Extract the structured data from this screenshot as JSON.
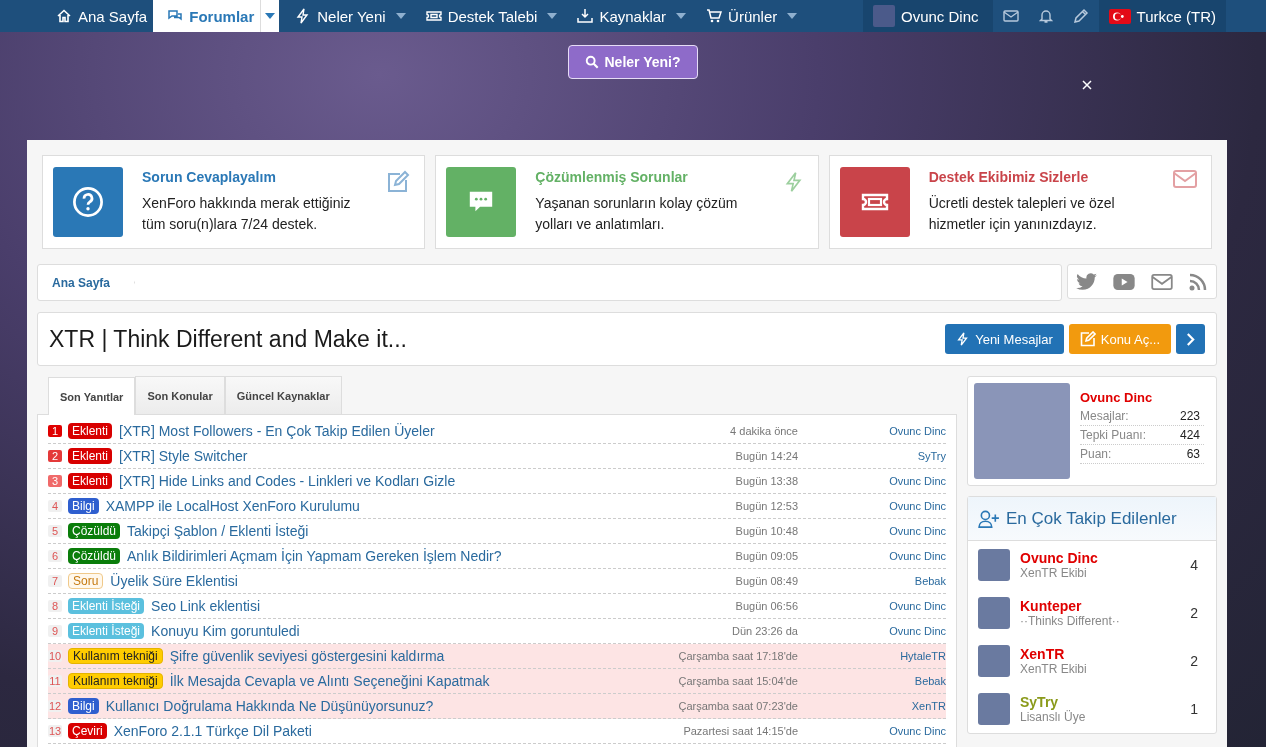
{
  "nav": {
    "items": [
      {
        "label": "Ana Sayfa",
        "kind": "home",
        "dropdown": false,
        "selected": false
      },
      {
        "label": "Forumlar",
        "kind": "chat",
        "dropdown": true,
        "selected": true
      },
      {
        "label": "Neler Yeni",
        "kind": "bolt",
        "dropdown": true,
        "selected": false
      },
      {
        "label": "Destek Talebi",
        "kind": "ticket",
        "dropdown": true,
        "selected": false
      },
      {
        "label": "Kaynaklar",
        "kind": "download",
        "dropdown": true,
        "selected": false
      },
      {
        "label": "Ürünler",
        "kind": "cart",
        "dropdown": true,
        "selected": false
      }
    ],
    "user": "Ovunc Dinc",
    "language": "Turkce (TR)"
  },
  "hero": {
    "button": "Neler Yeni?"
  },
  "features": [
    {
      "kind": "question",
      "title": "Sorun Cevaplayalım",
      "text": "XenForo hakkında merak ettiğiniz tüm soru(n)lara 7/24 destek.",
      "color": "#2a78b6"
    },
    {
      "kind": "solved",
      "title": "Çözümlenmiş Sorunlar",
      "text": "Yaşanan sorunların kolay çözüm yolları ve anlatımları.",
      "color": "#63b165"
    },
    {
      "kind": "support",
      "title": "Destek Ekibimiz Sizlerle",
      "text": "Ücretli destek talepleri ve özel hizmetler için yanınızdayız.",
      "color": "#c9444a"
    }
  ],
  "breadcrumb": [
    "Ana Sayfa"
  ],
  "page_title": "XTR | Think Different and Make it...",
  "actions": {
    "new_posts": "Yeni Mesajlar",
    "new_thread": "Konu Aç..."
  },
  "tabs": [
    {
      "label": "Son Yanıtlar",
      "selected": true
    },
    {
      "label": "Son Konular",
      "selected": false
    },
    {
      "label": "Güncel Kaynaklar",
      "selected": false
    }
  ],
  "threads": [
    {
      "rank": "1",
      "top": true,
      "prefix": {
        "text": "Eklenti",
        "kind": "plugin"
      },
      "title": "[XTR] Most Followers - En Çok Takip Edilen Üyeler",
      "time": "4 dakika önce",
      "user": "Ovunc Dinc",
      "highlighted": false
    },
    {
      "rank": "2",
      "top": true,
      "prefix": {
        "text": "Eklenti",
        "kind": "plugin"
      },
      "title": "[XTR] Style Switcher",
      "time": "Bugün 14:24",
      "user": "SyTry",
      "highlighted": false
    },
    {
      "rank": "3",
      "top": true,
      "prefix": {
        "text": "Eklenti",
        "kind": "plugin"
      },
      "title": "[XTR] Hide Links and Codes - Linkleri ve Kodları Gizle",
      "time": "Bugün 13:38",
      "user": "Ovunc Dinc",
      "highlighted": false
    },
    {
      "rank": "4",
      "top": false,
      "prefix": {
        "text": "Bilgi",
        "kind": "info"
      },
      "title": "XAMPP ile LocalHost XenForo Kurulumu",
      "time": "Bugün 12:53",
      "user": "Ovunc Dinc",
      "highlighted": false
    },
    {
      "rank": "5",
      "top": false,
      "prefix": {
        "text": "Çözüldü",
        "kind": "solved"
      },
      "title": "Takipçi Şablon / Eklenti İsteği",
      "time": "Bugün 10:48",
      "user": "Ovunc Dinc",
      "highlighted": false
    },
    {
      "rank": "6",
      "top": false,
      "prefix": {
        "text": "Çözüldü",
        "kind": "solved"
      },
      "title": "Anlık Bildirimleri Açmam İçin Yapmam Gereken İşlem Nedir?",
      "time": "Bugün 09:05",
      "user": "Ovunc Dinc",
      "highlighted": false
    },
    {
      "rank": "7",
      "top": false,
      "prefix": {
        "text": "Soru",
        "kind": "question"
      },
      "title": "Üyelik Süre Eklentisi",
      "time": "Bugün 08:49",
      "user": "Bebak",
      "highlighted": false
    },
    {
      "rank": "8",
      "top": false,
      "prefix": {
        "text": "Eklenti İsteği",
        "kind": "request"
      },
      "title": "Seo Link eklentisi",
      "time": "Bugün 06:56",
      "user": "Ovunc Dinc",
      "highlighted": false
    },
    {
      "rank": "9",
      "top": false,
      "prefix": {
        "text": "Eklenti İsteği",
        "kind": "request"
      },
      "title": "Konuyu Kim goruntuledi",
      "time": "Dün 23:26 da",
      "user": "Ovunc Dinc",
      "highlighted": false
    },
    {
      "rank": "10",
      "top": false,
      "prefix": {
        "text": "Kullanım tekniği",
        "kind": "howto"
      },
      "title": "Şifre güvenlik seviyesi göstergesini kaldırma",
      "time": "Çarşamba saat 17:18'de",
      "user": "HytaleTR",
      "highlighted": true
    },
    {
      "rank": "11",
      "top": false,
      "prefix": {
        "text": "Kullanım tekniği",
        "kind": "howto"
      },
      "title": "İlk Mesajda Cevapla ve Alıntı Seçeneğini Kapatmak",
      "time": "Çarşamba saat 15:04'de",
      "user": "Bebak",
      "highlighted": true
    },
    {
      "rank": "12",
      "top": false,
      "prefix": {
        "text": "Bilgi",
        "kind": "info"
      },
      "title": "Kullanıcı Doğrulama Hakkında Ne Düşünüyorsunuz?",
      "time": "Çarşamba saat 07:23'de",
      "user": "XenTR",
      "highlighted": true
    },
    {
      "rank": "13",
      "top": false,
      "prefix": {
        "text": "Çeviri",
        "kind": "translation"
      },
      "title": "XenForo 2.1.1 Türkçe Dil Paketi",
      "time": "Pazartesi saat 14:15'de",
      "user": "Ovunc Dinc",
      "highlighted": false
    }
  ],
  "profile": {
    "name": "Ovunc Dinc",
    "stats": [
      {
        "label": "Mesajlar:",
        "value": "223"
      },
      {
        "label": "Tepki Puanı:",
        "value": "424"
      },
      {
        "label": "Puan:",
        "value": "63"
      }
    ]
  },
  "most_followed": {
    "title": "En Çok Takip Edilenler",
    "members": [
      {
        "name": "Ovunc Dinc",
        "color": "#e00000",
        "subtitle": "XenTR Ekibi",
        "count": "4"
      },
      {
        "name": "Kunteper",
        "color": "#e00000",
        "subtitle": "··Thinks Different··",
        "count": "2"
      },
      {
        "name": "XenTR",
        "color": "#e00000",
        "subtitle": "XenTR Ekibi",
        "count": "2"
      },
      {
        "name": "SyTry",
        "color": "#8a9a1a",
        "subtitle": "Lisanslı Üye",
        "count": "1"
      }
    ]
  }
}
